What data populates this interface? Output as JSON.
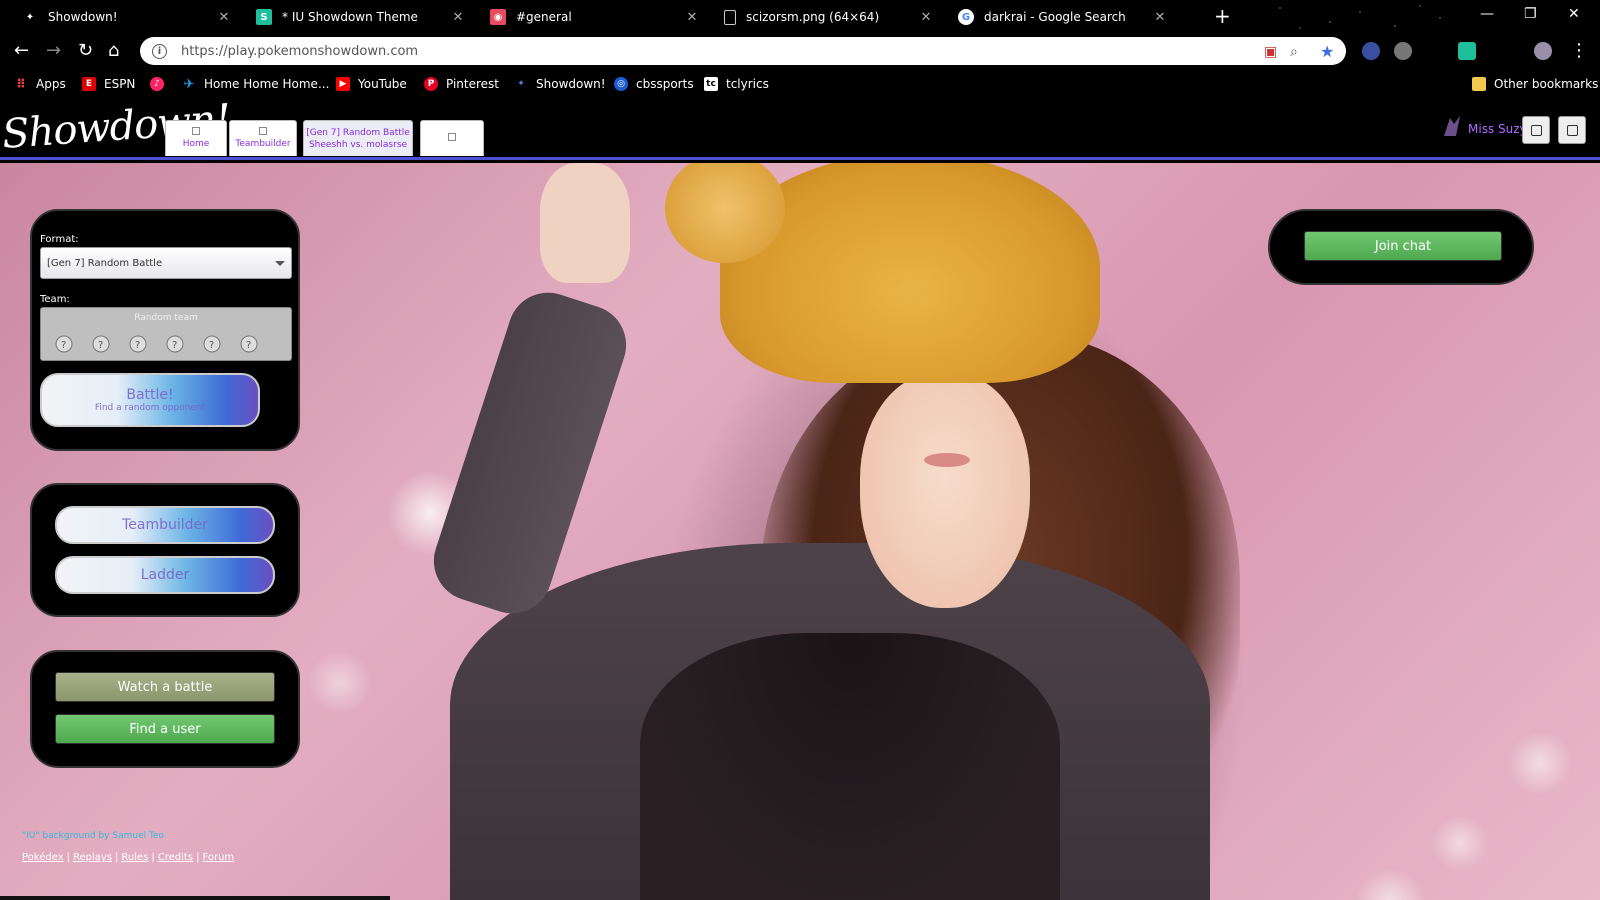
{
  "browser": {
    "tabs": [
      {
        "title": "Showdown!",
        "favicon": "pokeball-icon",
        "color": "#ffffff"
      },
      {
        "title": "* IU Showdown Theme",
        "favicon": "stylus-s-icon",
        "color": "#1fbf9c"
      },
      {
        "title": "#general",
        "favicon": "discord-icon",
        "color": "#e84a5f"
      },
      {
        "title": "scizorsm.png (64×64)",
        "favicon": "file-icon",
        "color": "#ffffff"
      },
      {
        "title": "darkrai - Google Search",
        "favicon": "google-icon",
        "color": "#ffffff"
      }
    ],
    "url": "https://play.pokemonshowdown.com",
    "bookmarks": [
      {
        "label": "Apps",
        "icon": "apps-grid-icon",
        "color": "#e44"
      },
      {
        "label": "ESPN",
        "icon": "espn-icon",
        "color": "#d00"
      },
      {
        "label": "",
        "icon": "music-icon",
        "color": "#f26"
      },
      {
        "label": "Home Home Home...",
        "icon": "twitter-icon",
        "color": "#1da1f2"
      },
      {
        "label": "YouTube",
        "icon": "youtube-icon",
        "color": "#f00"
      },
      {
        "label": "Pinterest",
        "icon": "pinterest-icon",
        "color": "#e60023"
      },
      {
        "label": "Showdown!",
        "icon": "showdown-icon",
        "color": "#5a7fd6"
      },
      {
        "label": "cbssports",
        "icon": "cbs-icon",
        "color": "#1b5bd6"
      },
      {
        "label": "tclyrics",
        "icon": "lyrics-icon",
        "color": "#fff"
      }
    ],
    "other_bookmarks": "Other bookmarks"
  },
  "header": {
    "logo": "Showdown!",
    "tabs": [
      {
        "line1": "Home",
        "line2": ""
      },
      {
        "line1": "Teambuilder",
        "line2": ""
      },
      {
        "line1": "[Gen 7] Random Battle",
        "line2": "Sheeshh vs. molasrse"
      }
    ],
    "username": "Miss Suzy"
  },
  "battle_panel": {
    "format_label": "Format:",
    "format_value": "[Gen 7] Random Battle",
    "team_label": "Team:",
    "team_value": "Random team",
    "battle_btn_title": "Battle!",
    "battle_btn_sub": "Find a random opponent"
  },
  "menu_panel": {
    "teambuilder": "Teambuilder",
    "ladder": "Ladder"
  },
  "watch_panel": {
    "watch": "Watch a battle",
    "find": "Find a user"
  },
  "chat": {
    "join": "Join chat"
  },
  "footer": {
    "credit": "\"IU\" background by Samuel Teo",
    "links": [
      "Pokédex",
      "Replays",
      "Rules",
      "Credits",
      "Forum"
    ]
  },
  "colors": {
    "accent_bar": "#4b52d8",
    "green_btn": "#5cb85c",
    "olive_btn": "#9aa47c",
    "username": "#b06cff"
  }
}
